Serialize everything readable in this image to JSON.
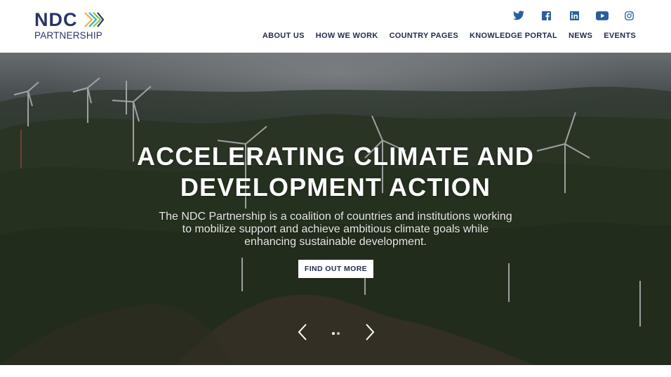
{
  "logo": {
    "name": "NDC",
    "subtitle": "PARTNERSHIP",
    "chevron_colors": [
      "#f2b134",
      "#2bb3c0",
      "#2a3466",
      "#8cc63f"
    ]
  },
  "social": [
    {
      "icon": "twitter-icon"
    },
    {
      "icon": "facebook-icon"
    },
    {
      "icon": "linkedin-icon"
    },
    {
      "icon": "youtube-icon"
    },
    {
      "icon": "instagram-icon"
    }
  ],
  "nav": {
    "items": [
      {
        "label": "ABOUT US"
      },
      {
        "label": "HOW WE WORK"
      },
      {
        "label": "COUNTRY PAGES"
      },
      {
        "label": "KNOWLEDGE PORTAL"
      },
      {
        "label": "NEWS"
      },
      {
        "label": "EVENTS"
      }
    ]
  },
  "hero": {
    "title_line1": "ACCELERATING CLIMATE AND",
    "title_line2": "DEVELOPMENT ACTION",
    "text_line1": "The NDC Partnership is a coalition of countries and institutions working",
    "text_line2": "to mobilize support and achieve ambitious climate goals while",
    "text_line3": "enhancing sustainable development.",
    "button_label": "FIND OUT MORE",
    "slide_count": 2,
    "active_slide": 1
  },
  "colors": {
    "brand_navy": "#1f2a4a",
    "social_blue": "#2a5f9e"
  }
}
